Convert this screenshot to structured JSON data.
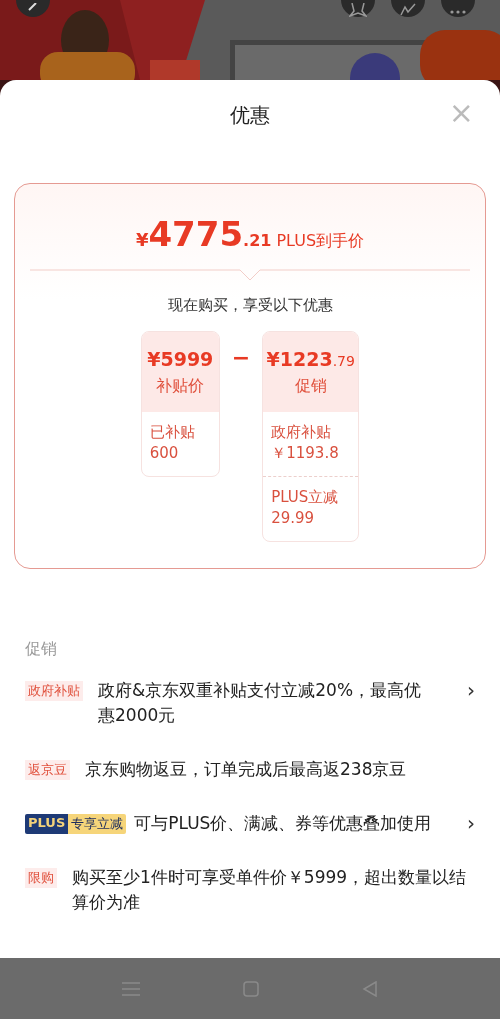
{
  "sheet": {
    "title": "优惠",
    "close": "×"
  },
  "price_card": {
    "currency": "¥",
    "integer": "4775",
    "decimal": ".21",
    "label": "PLUS到手价",
    "subtitle": "现在购买，享受以下优惠",
    "operator": "−",
    "base": {
      "amount": "¥5999",
      "label": "补贴价",
      "details": [
        {
          "label": "已补贴",
          "value": "600"
        }
      ]
    },
    "discount": {
      "amount": "¥1223",
      "amount_decimal": ".79",
      "label": "促销",
      "details": [
        {
          "label": "政府补贴",
          "value": "￥1193.8"
        },
        {
          "label": "PLUS立减",
          "value": "29.99"
        }
      ]
    }
  },
  "promotions": {
    "title": "促销",
    "items": [
      {
        "kind": "tag",
        "tag": "政府补贴",
        "text": "政府&京东双重补贴支付立减20%，最高优惠2000元",
        "arrow": "›"
      },
      {
        "kind": "tag",
        "tag": "返京豆",
        "text": "京东购物返豆，订单完成后最高返238京豆"
      },
      {
        "kind": "plus",
        "brand": "PLUS",
        "tag": "专享立减",
        "text": "可与PLUS价、满减、券等优惠叠加使用",
        "arrow": "›"
      },
      {
        "kind": "tag",
        "tag": "限购",
        "text": "购买至少1件时可享受单件价￥5999，超出数量以结算价为准"
      }
    ]
  }
}
